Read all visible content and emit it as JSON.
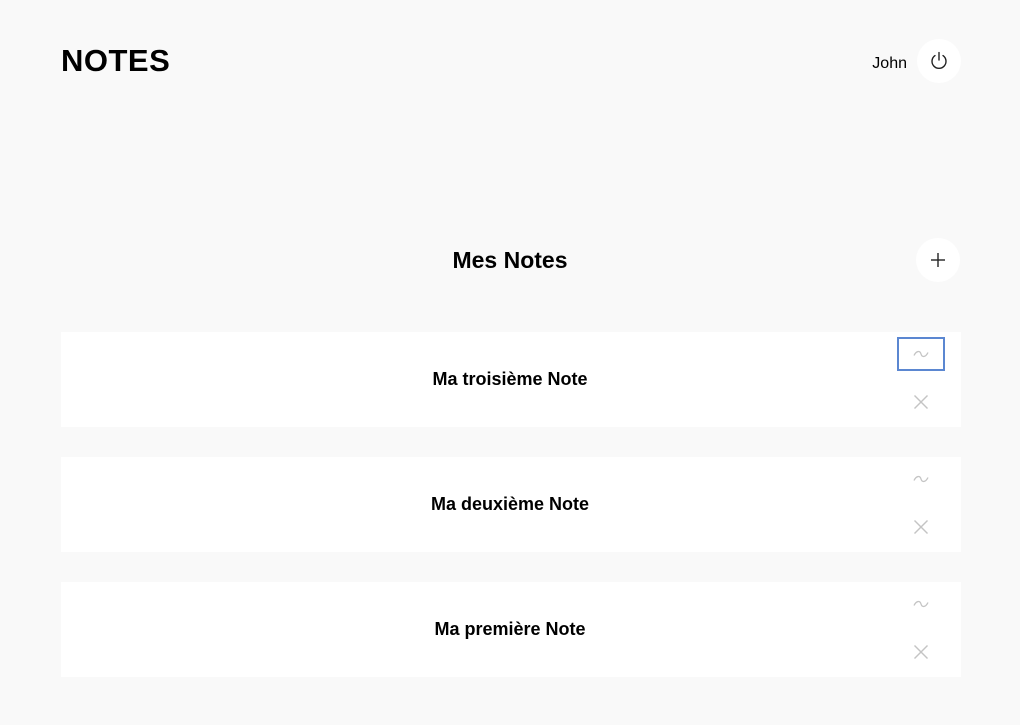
{
  "header": {
    "logo": "NOTES",
    "user_name": "John",
    "logout_icon": "power-icon"
  },
  "main": {
    "title": "Mes Notes",
    "add_icon": "plus-icon",
    "notes": [
      {
        "title": "Ma troisième Note",
        "edit_icon": "tilde-edit-icon",
        "delete_icon": "close-icon",
        "focused_action": "edit"
      },
      {
        "title": "Ma deuxième Note",
        "edit_icon": "tilde-edit-icon",
        "delete_icon": "close-icon"
      },
      {
        "title": "Ma première Note",
        "edit_icon": "tilde-edit-icon",
        "delete_icon": "close-icon"
      }
    ]
  },
  "colors": {
    "background": "#f9f9f9",
    "card": "#ffffff",
    "focus_ring": "#5b87d1",
    "muted_icon": "#c4c4c4"
  }
}
